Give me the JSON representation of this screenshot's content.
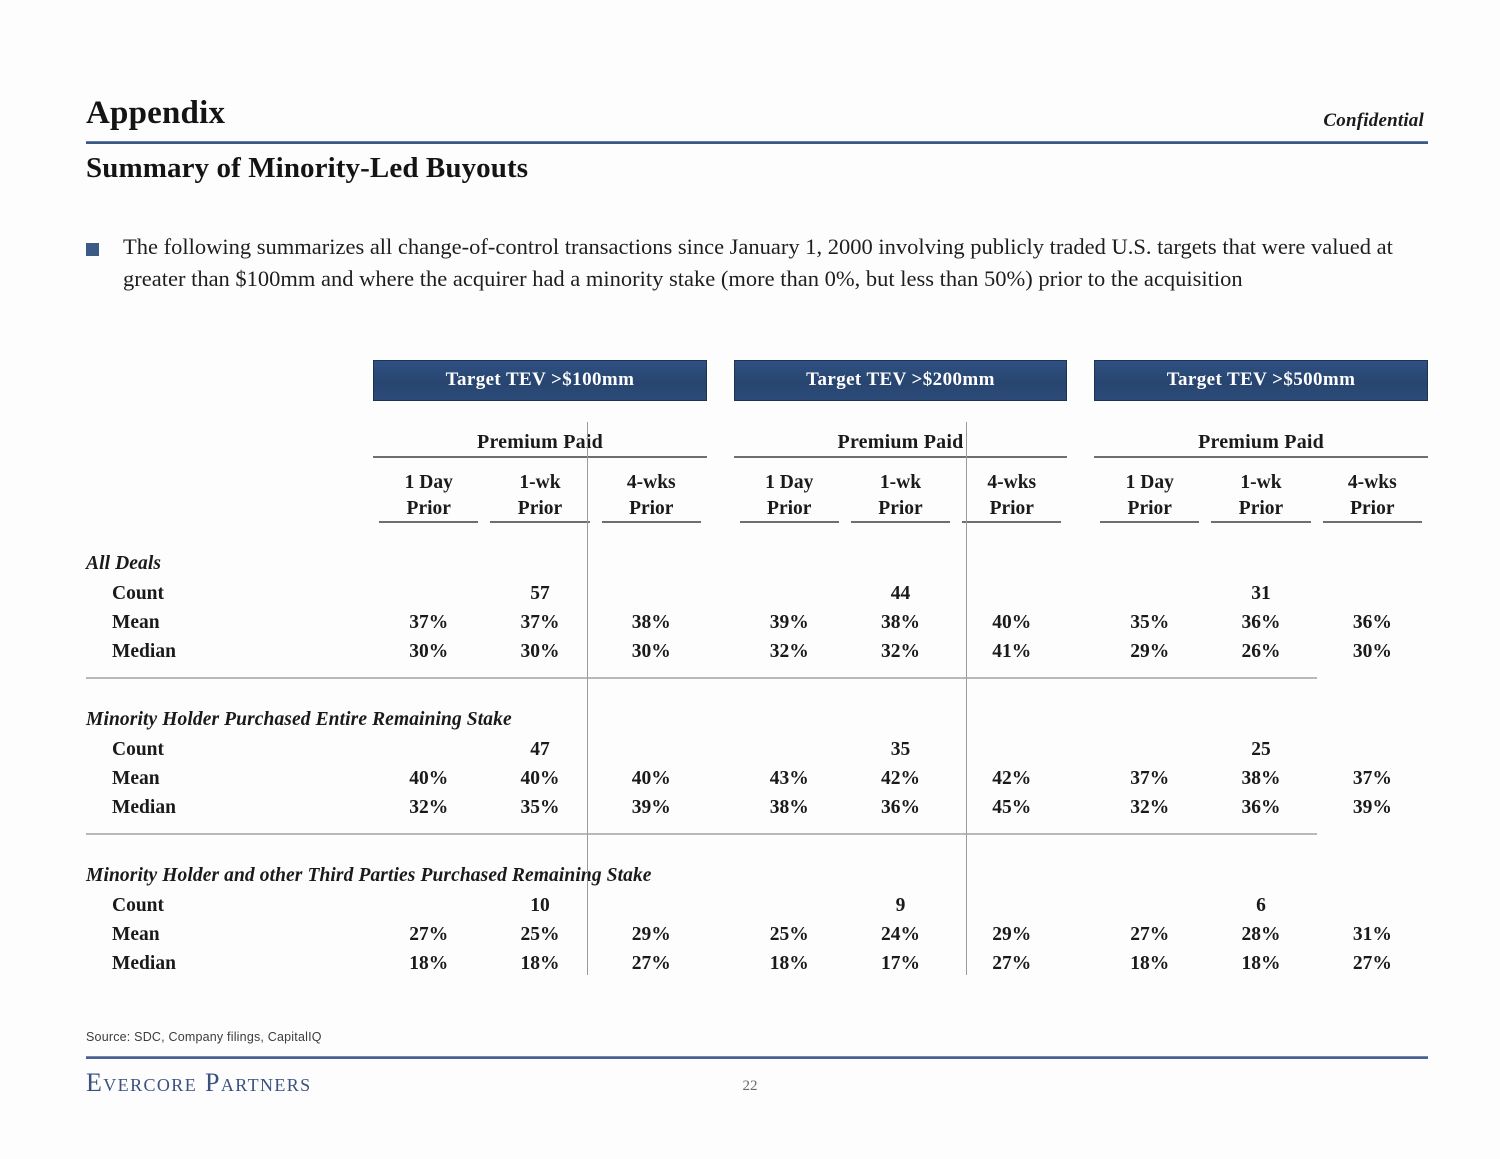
{
  "header": {
    "appendix_title": "Appendix",
    "confidential": "Confidential",
    "page_title": "Summary of Minority-Led Buyouts"
  },
  "bullet": {
    "text": "The following summarizes all change-of-control transactions since January 1, 2000 involving publicly traded U.S. targets that were valued at greater than $100mm and where the acquirer had a minority stake (more than 0%, but less than 50%) prior to the acquisition"
  },
  "table": {
    "panels": [
      {
        "banner": "Target TEV >$100mm"
      },
      {
        "banner": "Target TEV >$200mm"
      },
      {
        "banner": "Target TEV >$500mm"
      }
    ],
    "premium_paid_label": "Premium Paid",
    "sub_headers": [
      "1 Day\nPrior",
      "1-wk\nPrior",
      "4-wks\nPrior"
    ],
    "row_labels": {
      "count": "Count",
      "mean": "Mean",
      "median": "Median"
    },
    "groups": [
      {
        "title": "All Deals",
        "counts": [
          "57",
          "44",
          "31"
        ],
        "mean": [
          [
            "37%",
            "37%",
            "38%"
          ],
          [
            "39%",
            "38%",
            "40%"
          ],
          [
            "35%",
            "36%",
            "36%"
          ]
        ],
        "median": [
          [
            "30%",
            "30%",
            "30%"
          ],
          [
            "32%",
            "32%",
            "41%"
          ],
          [
            "29%",
            "26%",
            "30%"
          ]
        ]
      },
      {
        "title": "Minority Holder Purchased Entire Remaining Stake",
        "counts": [
          "47",
          "35",
          "25"
        ],
        "mean": [
          [
            "40%",
            "40%",
            "40%"
          ],
          [
            "43%",
            "42%",
            "42%"
          ],
          [
            "37%",
            "38%",
            "37%"
          ]
        ],
        "median": [
          [
            "32%",
            "35%",
            "39%"
          ],
          [
            "38%",
            "36%",
            "45%"
          ],
          [
            "32%",
            "36%",
            "39%"
          ]
        ]
      },
      {
        "title": "Minority Holder and other Third Parties Purchased Remaining Stake",
        "counts": [
          "10",
          "9",
          "6"
        ],
        "mean": [
          [
            "27%",
            "25%",
            "29%"
          ],
          [
            "25%",
            "24%",
            "29%"
          ],
          [
            "27%",
            "28%",
            "31%"
          ]
        ],
        "median": [
          [
            "18%",
            "18%",
            "27%"
          ],
          [
            "18%",
            "17%",
            "27%"
          ],
          [
            "18%",
            "18%",
            "27%"
          ]
        ]
      }
    ]
  },
  "footer": {
    "source": "Source:  SDC, Company filings, CapitalIQ",
    "logo": "Evercore Partners",
    "page_number": "22"
  },
  "colors": {
    "banner_blue": "#2c4b79",
    "rule_blue": "#3b578a",
    "bullet_blue": "#3c5a86",
    "logo_blue": "#3a5180"
  }
}
